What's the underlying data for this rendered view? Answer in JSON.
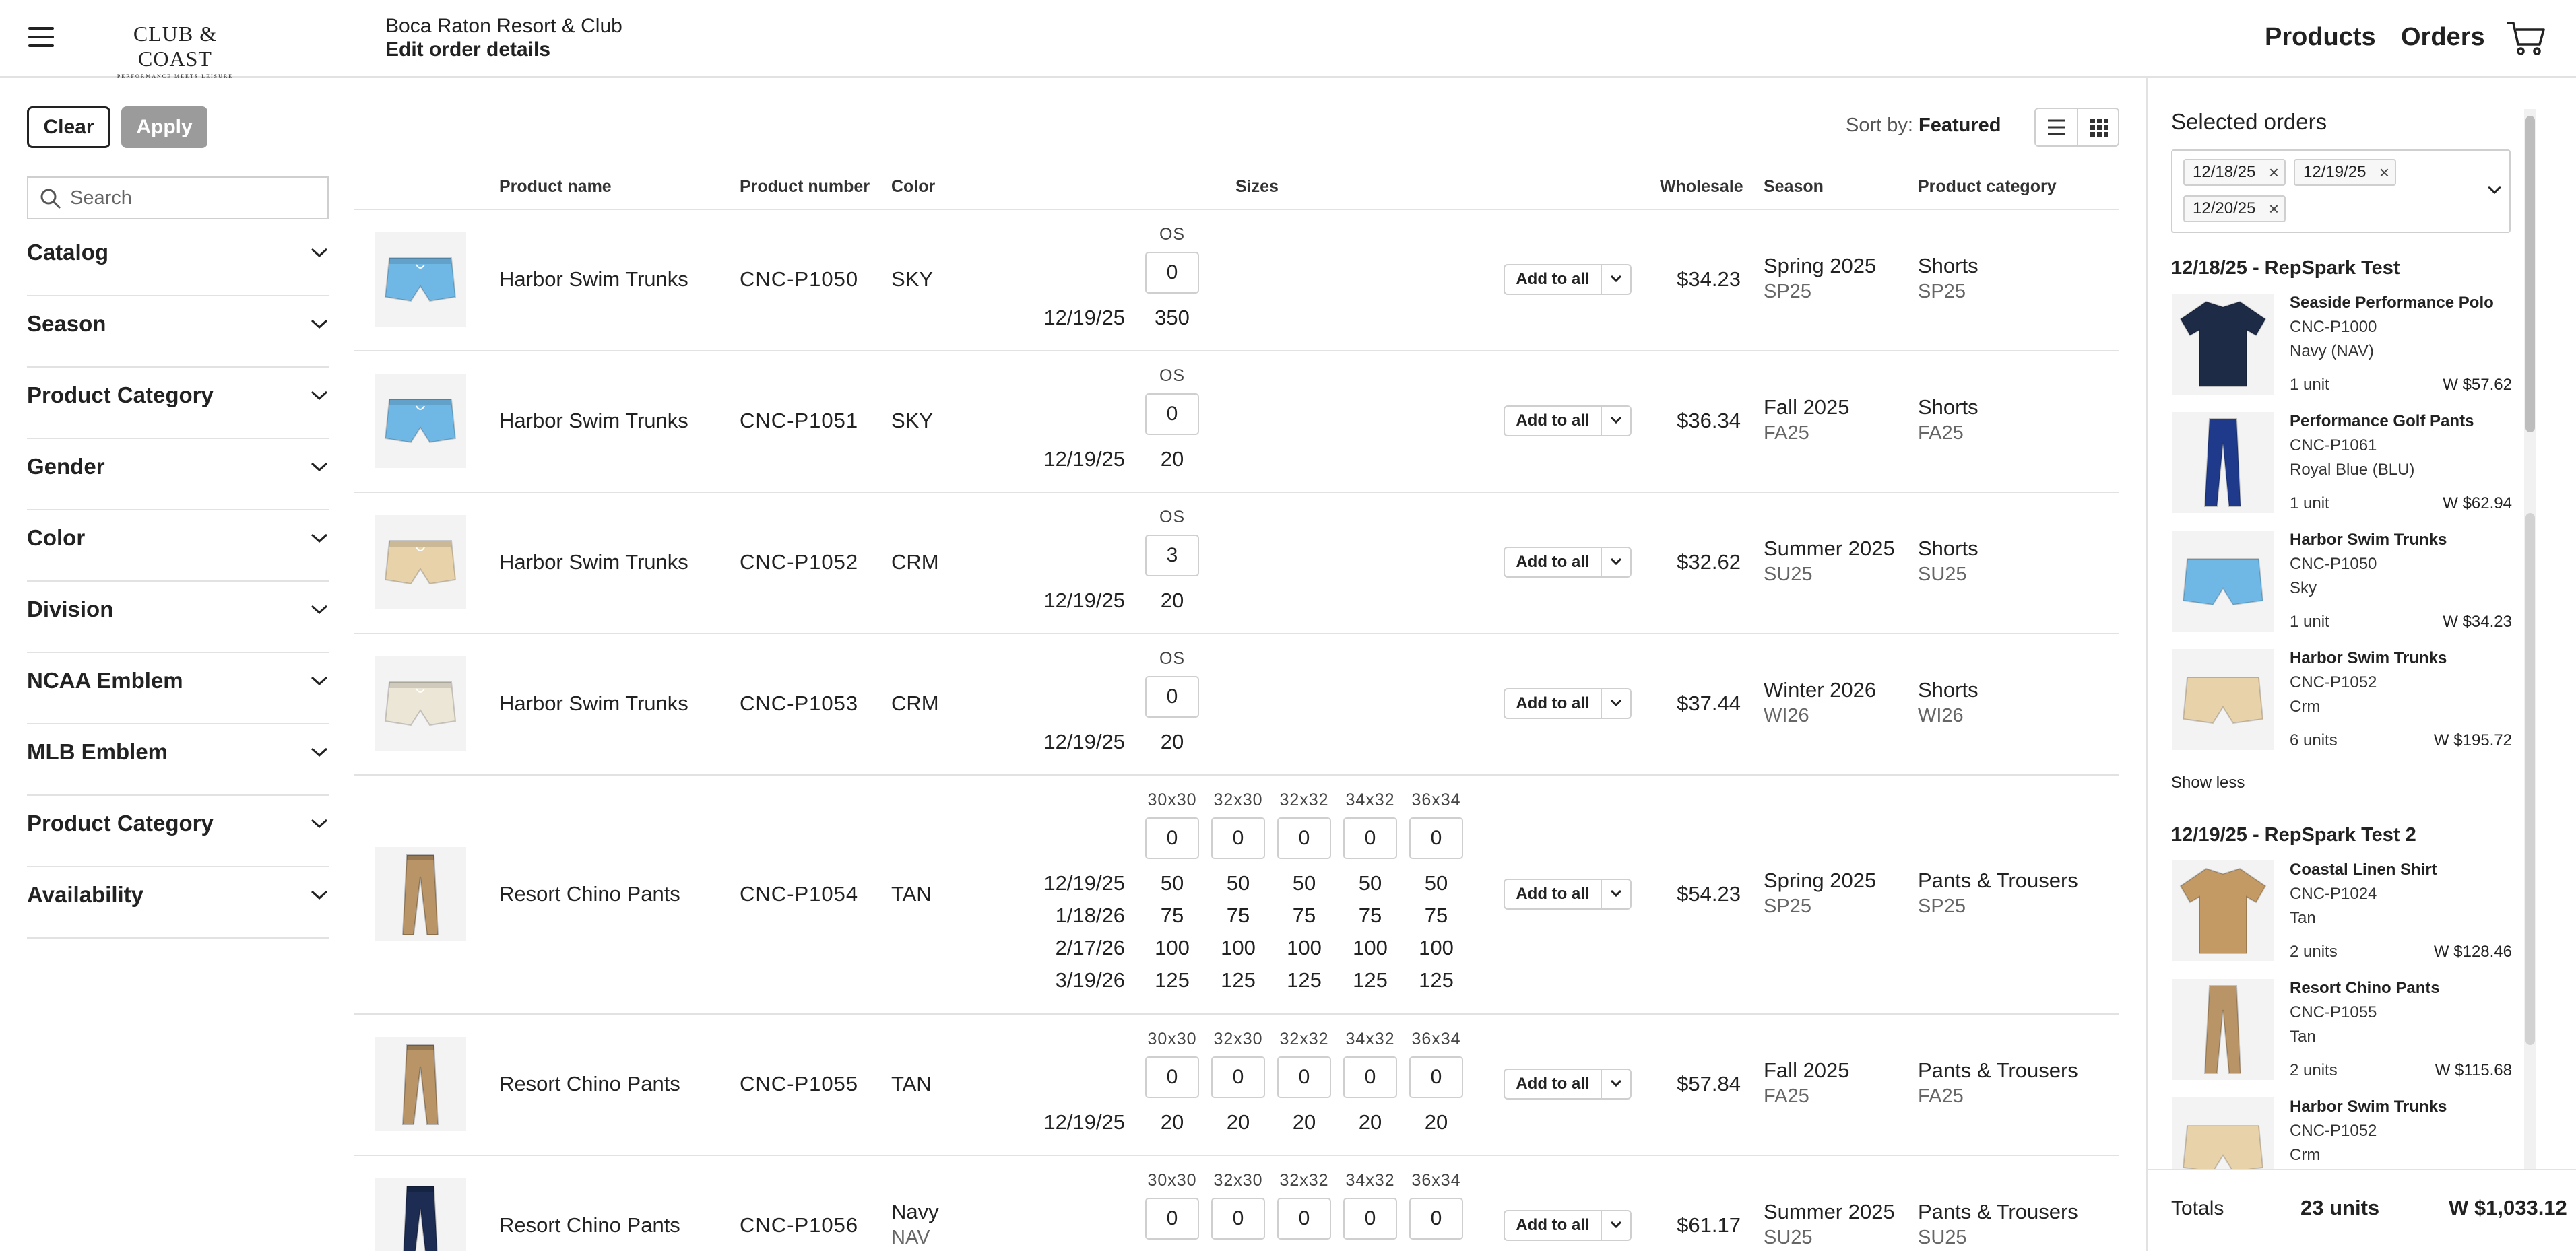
{
  "header": {
    "logo_main": "CLUB & COAST",
    "logo_tagline": "PERFORMANCE MEETS LEISURE",
    "account": "Boca Raton Resort & Club",
    "page_title": "Edit order details",
    "nav": [
      "Products",
      "Orders"
    ]
  },
  "filters": {
    "clear_label": "Clear",
    "apply_label": "Apply",
    "search_placeholder": "Search",
    "facets": [
      "Catalog",
      "Season",
      "Product Category",
      "Gender",
      "Color",
      "Division",
      "NCAA Emblem",
      "MLB Emblem",
      "Product Category",
      "Availability"
    ]
  },
  "toolbar": {
    "sort_label": "Sort by:",
    "sort_value": "Featured"
  },
  "table": {
    "headers": {
      "name": "Product name",
      "number": "Product number",
      "color": "Color",
      "sizes": "Sizes",
      "wholesale": "Wholesale",
      "season": "Season",
      "category": "Product category"
    },
    "add_to_all_label": "Add to all",
    "rows": [
      {
        "name": "Harbor Swim Trunks",
        "number": "CNC-P1050",
        "color": "SKY",
        "color_sub": "",
        "swatch": "#6fb8e6",
        "sizes": [
          "OS"
        ],
        "qty": [
          "0"
        ],
        "dates": [
          {
            "date": "12/19/25",
            "avail": [
              "350"
            ]
          }
        ],
        "wholesale": "$34.23",
        "season": "Spring 2025",
        "season_code": "SP25",
        "category": "Shorts",
        "category_code": "SP25"
      },
      {
        "name": "Harbor Swim Trunks",
        "number": "CNC-P1051",
        "color": "SKY",
        "color_sub": "",
        "swatch": "#6fb8e6",
        "sizes": [
          "OS"
        ],
        "qty": [
          "0"
        ],
        "dates": [
          {
            "date": "12/19/25",
            "avail": [
              "20"
            ]
          }
        ],
        "wholesale": "$36.34",
        "season": "Fall 2025",
        "season_code": "FA25",
        "category": "Shorts",
        "category_code": "FA25"
      },
      {
        "name": "Harbor Swim Trunks",
        "number": "CNC-P1052",
        "color": "CRM",
        "color_sub": "",
        "swatch": "#e8d2aa",
        "sizes": [
          "OS"
        ],
        "qty": [
          "3"
        ],
        "dates": [
          {
            "date": "12/19/25",
            "avail": [
              "20"
            ]
          }
        ],
        "wholesale": "$32.62",
        "season": "Summer 2025",
        "season_code": "SU25",
        "category": "Shorts",
        "category_code": "SU25"
      },
      {
        "name": "Harbor Swim Trunks",
        "number": "CNC-P1053",
        "color": "CRM",
        "color_sub": "",
        "swatch": "#ece6d6",
        "sizes": [
          "OS"
        ],
        "qty": [
          "0"
        ],
        "dates": [
          {
            "date": "12/19/25",
            "avail": [
              "20"
            ]
          }
        ],
        "wholesale": "$37.44",
        "season": "Winter 2026",
        "season_code": "WI26",
        "category": "Shorts",
        "category_code": "WI26"
      },
      {
        "name": "Resort Chino Pants",
        "number": "CNC-P1054",
        "color": "TAN",
        "color_sub": "",
        "swatch": "#b89466",
        "sizes": [
          "30x30",
          "32x30",
          "32x32",
          "34x32",
          "36x34"
        ],
        "qty": [
          "0",
          "0",
          "0",
          "0",
          "0"
        ],
        "dates": [
          {
            "date": "12/19/25",
            "avail": [
              "50",
              "50",
              "50",
              "50",
              "50"
            ]
          },
          {
            "date": "1/18/26",
            "avail": [
              "75",
              "75",
              "75",
              "75",
              "75"
            ]
          },
          {
            "date": "2/17/26",
            "avail": [
              "100",
              "100",
              "100",
              "100",
              "100"
            ]
          },
          {
            "date": "3/19/26",
            "avail": [
              "125",
              "125",
              "125",
              "125",
              "125"
            ]
          }
        ],
        "wholesale": "$54.23",
        "season": "Spring 2025",
        "season_code": "SP25",
        "category": "Pants & Trousers",
        "category_code": "SP25"
      },
      {
        "name": "Resort Chino Pants",
        "number": "CNC-P1055",
        "color": "TAN",
        "color_sub": "",
        "swatch": "#b89466",
        "sizes": [
          "30x30",
          "32x30",
          "32x32",
          "34x32",
          "36x34"
        ],
        "qty": [
          "0",
          "0",
          "0",
          "0",
          "0"
        ],
        "dates": [
          {
            "date": "12/19/25",
            "avail": [
              "20",
              "20",
              "20",
              "20",
              "20"
            ]
          }
        ],
        "wholesale": "$57.84",
        "season": "Fall 2025",
        "season_code": "FA25",
        "category": "Pants & Trousers",
        "category_code": "FA25"
      },
      {
        "name": "Resort Chino Pants",
        "number": "CNC-P1056",
        "color": "Navy",
        "color_sub": "NAV",
        "swatch": "#1c2c52",
        "sizes": [
          "30x30",
          "32x30",
          "32x32",
          "34x32",
          "36x34"
        ],
        "qty": [
          "0",
          "0",
          "0",
          "0",
          "0"
        ],
        "dates": [],
        "wholesale": "$61.17",
        "season": "Summer 2025",
        "season_code": "SU25",
        "category": "Pants & Trousers",
        "category_code": "SU25"
      }
    ]
  },
  "cart_panel": {
    "title": "Selected orders",
    "chips": [
      "12/18/25",
      "12/19/25",
      "12/20/25"
    ],
    "groups": [
      {
        "title": "12/18/25 - RepSpark Test",
        "items": [
          {
            "name": "Seaside Performance Polo",
            "sku": "CNC-P1000",
            "color": "Navy (NAV)",
            "units": "1 unit",
            "price": "W $57.62",
            "swatch": "#1d2b47"
          },
          {
            "name": "Performance Golf Pants",
            "sku": "CNC-P1061",
            "color": "Royal Blue (BLU)",
            "units": "1 unit",
            "price": "W $62.94",
            "swatch": "#1f3a8a"
          },
          {
            "name": "Harbor Swim Trunks",
            "sku": "CNC-P1050",
            "color": "Sky",
            "units": "1 unit",
            "price": "W $34.23",
            "swatch": "#6fb8e6"
          },
          {
            "name": "Harbor Swim Trunks",
            "sku": "CNC-P1052",
            "color": "Crm",
            "units": "6 units",
            "price": "W $195.72",
            "swatch": "#e8d2aa"
          }
        ]
      },
      {
        "title": "12/19/25 - RepSpark Test 2",
        "items": [
          {
            "name": "Coastal Linen Shirt",
            "sku": "CNC-P1024",
            "color": "Tan",
            "units": "2 units",
            "price": "W $128.46",
            "swatch": "#c49a64"
          },
          {
            "name": "Resort Chino Pants",
            "sku": "CNC-P1055",
            "color": "Tan",
            "units": "2 units",
            "price": "W $115.68",
            "swatch": "#b89466"
          },
          {
            "name": "Harbor Swim Trunks",
            "sku": "CNC-P1052",
            "color": "Crm",
            "units": "",
            "price": "",
            "swatch": "#e8d2aa"
          }
        ]
      }
    ],
    "show_less": "Show less",
    "totals_label": "Totals",
    "totals_units": "23 units",
    "totals_amount": "W $1,033.12"
  }
}
